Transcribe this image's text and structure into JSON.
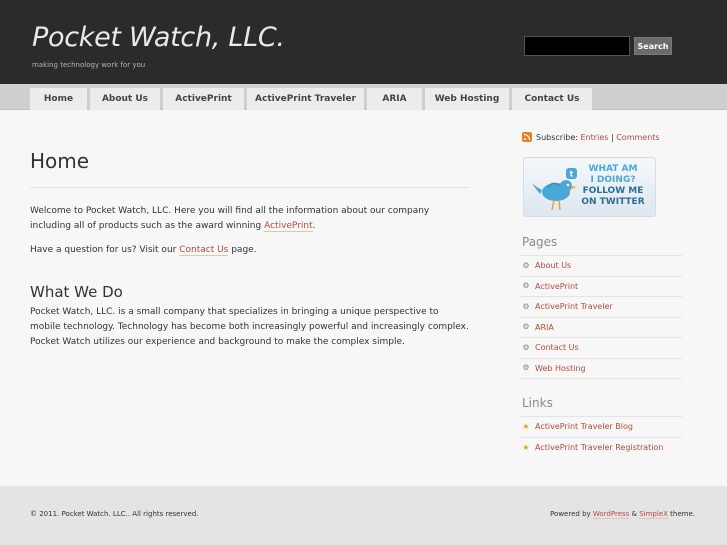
{
  "header": {
    "site_title": "Pocket Watch, LLC.",
    "tagline": "making technology work for you",
    "search_placeholder": "",
    "search_button": "Search"
  },
  "nav": {
    "items": [
      {
        "label": "Home"
      },
      {
        "label": "About Us"
      },
      {
        "label": "ActivePrint"
      },
      {
        "label": "ActivePrint Traveler"
      },
      {
        "label": "ARIA"
      },
      {
        "label": "Web Hosting"
      },
      {
        "label": "Contact Us"
      }
    ]
  },
  "main": {
    "page_title": "Home",
    "intro_before": "Welcome to Pocket Watch, LLC. Here you will find all the information about our company including all of products such as the award winning ",
    "intro_link": "ActivePrint",
    "intro_after": ".",
    "question_before": "Have a question for us? Visit our ",
    "question_link": "Contact Us",
    "question_after": " page.",
    "section_title": "What We Do",
    "section_text": "Pocket Watch, LLC. is a small company that specializes in bringing a unique perspective to mobile technology. Technology has become both increasingly powerful and increasingly complex. Pocket Watch utilizes our experience and background to make the complex simple."
  },
  "sidebar": {
    "subscribe_label": "Subscribe:",
    "subscribe_entries": "Entries",
    "subscribe_sep": "|",
    "subscribe_comments": "Comments",
    "twitter_line1": "WHAT AM",
    "twitter_line2": "I DOING?",
    "twitter_line3": "FOLLOW ME",
    "twitter_line4": "ON TWITTER",
    "pages_title": "Pages",
    "pages": [
      {
        "label": "About Us",
        "icon": "gear-icon"
      },
      {
        "label": "ActivePrint",
        "icon": "gear-icon"
      },
      {
        "label": "ActivePrint Traveler",
        "icon": "gear-icon"
      },
      {
        "label": "ARIA",
        "icon": "gear-icon"
      },
      {
        "label": "Contact Us",
        "icon": "gear-icon"
      },
      {
        "label": "Web Hosting",
        "icon": "gear-icon"
      }
    ],
    "links_title": "Links",
    "links": [
      {
        "label": "ActivePrint Traveler Blog",
        "icon": "star-icon"
      },
      {
        "label": "ActivePrint Traveler Registration",
        "icon": "star-icon"
      }
    ]
  },
  "footer": {
    "copyright": "© 2011. Pocket Watch. LLC.. All rights reserved.",
    "powered_before": "Powered by ",
    "powered_wp": "WordPress",
    "powered_amp": " & ",
    "powered_theme": "SimpleX",
    "powered_after": " theme."
  },
  "colors": {
    "header_bg": "#2b2b2a",
    "link": "#b34a3c",
    "nav_bar": "#cfcfcf",
    "nav_tab": "#ececec"
  }
}
